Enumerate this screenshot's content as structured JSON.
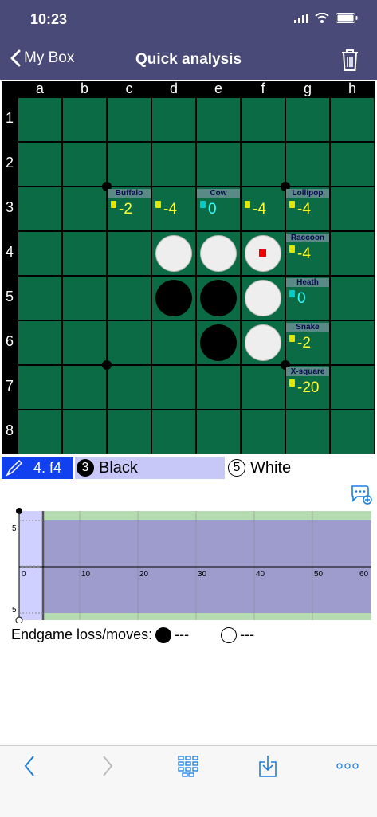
{
  "status": {
    "time": "10:23"
  },
  "nav": {
    "back_label": "My Box",
    "title": "Quick analysis"
  },
  "board": {
    "cols": [
      "a",
      "b",
      "c",
      "d",
      "e",
      "f",
      "g",
      "h"
    ],
    "rows": [
      "1",
      "2",
      "3",
      "4",
      "5",
      "6",
      "7",
      "8"
    ],
    "white_discs": [
      [
        3,
        3
      ],
      [
        3,
        4
      ],
      [
        3,
        5
      ],
      [
        4,
        5
      ],
      [
        5,
        5
      ]
    ],
    "black_discs": [
      [
        4,
        3
      ],
      [
        4,
        4
      ],
      [
        5,
        4
      ]
    ],
    "last_move": [
      3,
      5
    ],
    "analysis": [
      {
        "row": 2,
        "col": 2,
        "name": "Buffalo",
        "score": "-2",
        "color": "y"
      },
      {
        "row": 2,
        "col": 3,
        "name": "",
        "score": "-4",
        "color": "y"
      },
      {
        "row": 2,
        "col": 4,
        "name": "Cow",
        "score": "0",
        "color": "c"
      },
      {
        "row": 2,
        "col": 5,
        "name": "",
        "score": "-4",
        "color": "y"
      },
      {
        "row": 2,
        "col": 6,
        "name": "Lollipop",
        "score": "-4",
        "color": "y"
      },
      {
        "row": 3,
        "col": 6,
        "name": "Raccoon",
        "score": "-4",
        "color": "y"
      },
      {
        "row": 4,
        "col": 6,
        "name": "Heath",
        "score": "0",
        "color": "c"
      },
      {
        "row": 5,
        "col": 6,
        "name": "Snake",
        "score": "-2",
        "color": "y"
      },
      {
        "row": 6,
        "col": 6,
        "name": "X-square",
        "score": "-20",
        "color": "y"
      }
    ]
  },
  "move_bar": {
    "move_label": "4. f4",
    "black_count": "3",
    "black_label": "Black",
    "white_count": "5",
    "white_label": "White"
  },
  "graph": {
    "y_top": "5",
    "y_bottom": "5",
    "x_ticks": [
      "0",
      "10",
      "20",
      "30",
      "40",
      "50",
      "60"
    ]
  },
  "endgame": {
    "label": "Endgame loss/moves:",
    "black_value": "---",
    "white_value": "---"
  },
  "colors": {
    "bar": "#4a4a78",
    "board": "#0a6b45",
    "accent": "#1140ee"
  }
}
